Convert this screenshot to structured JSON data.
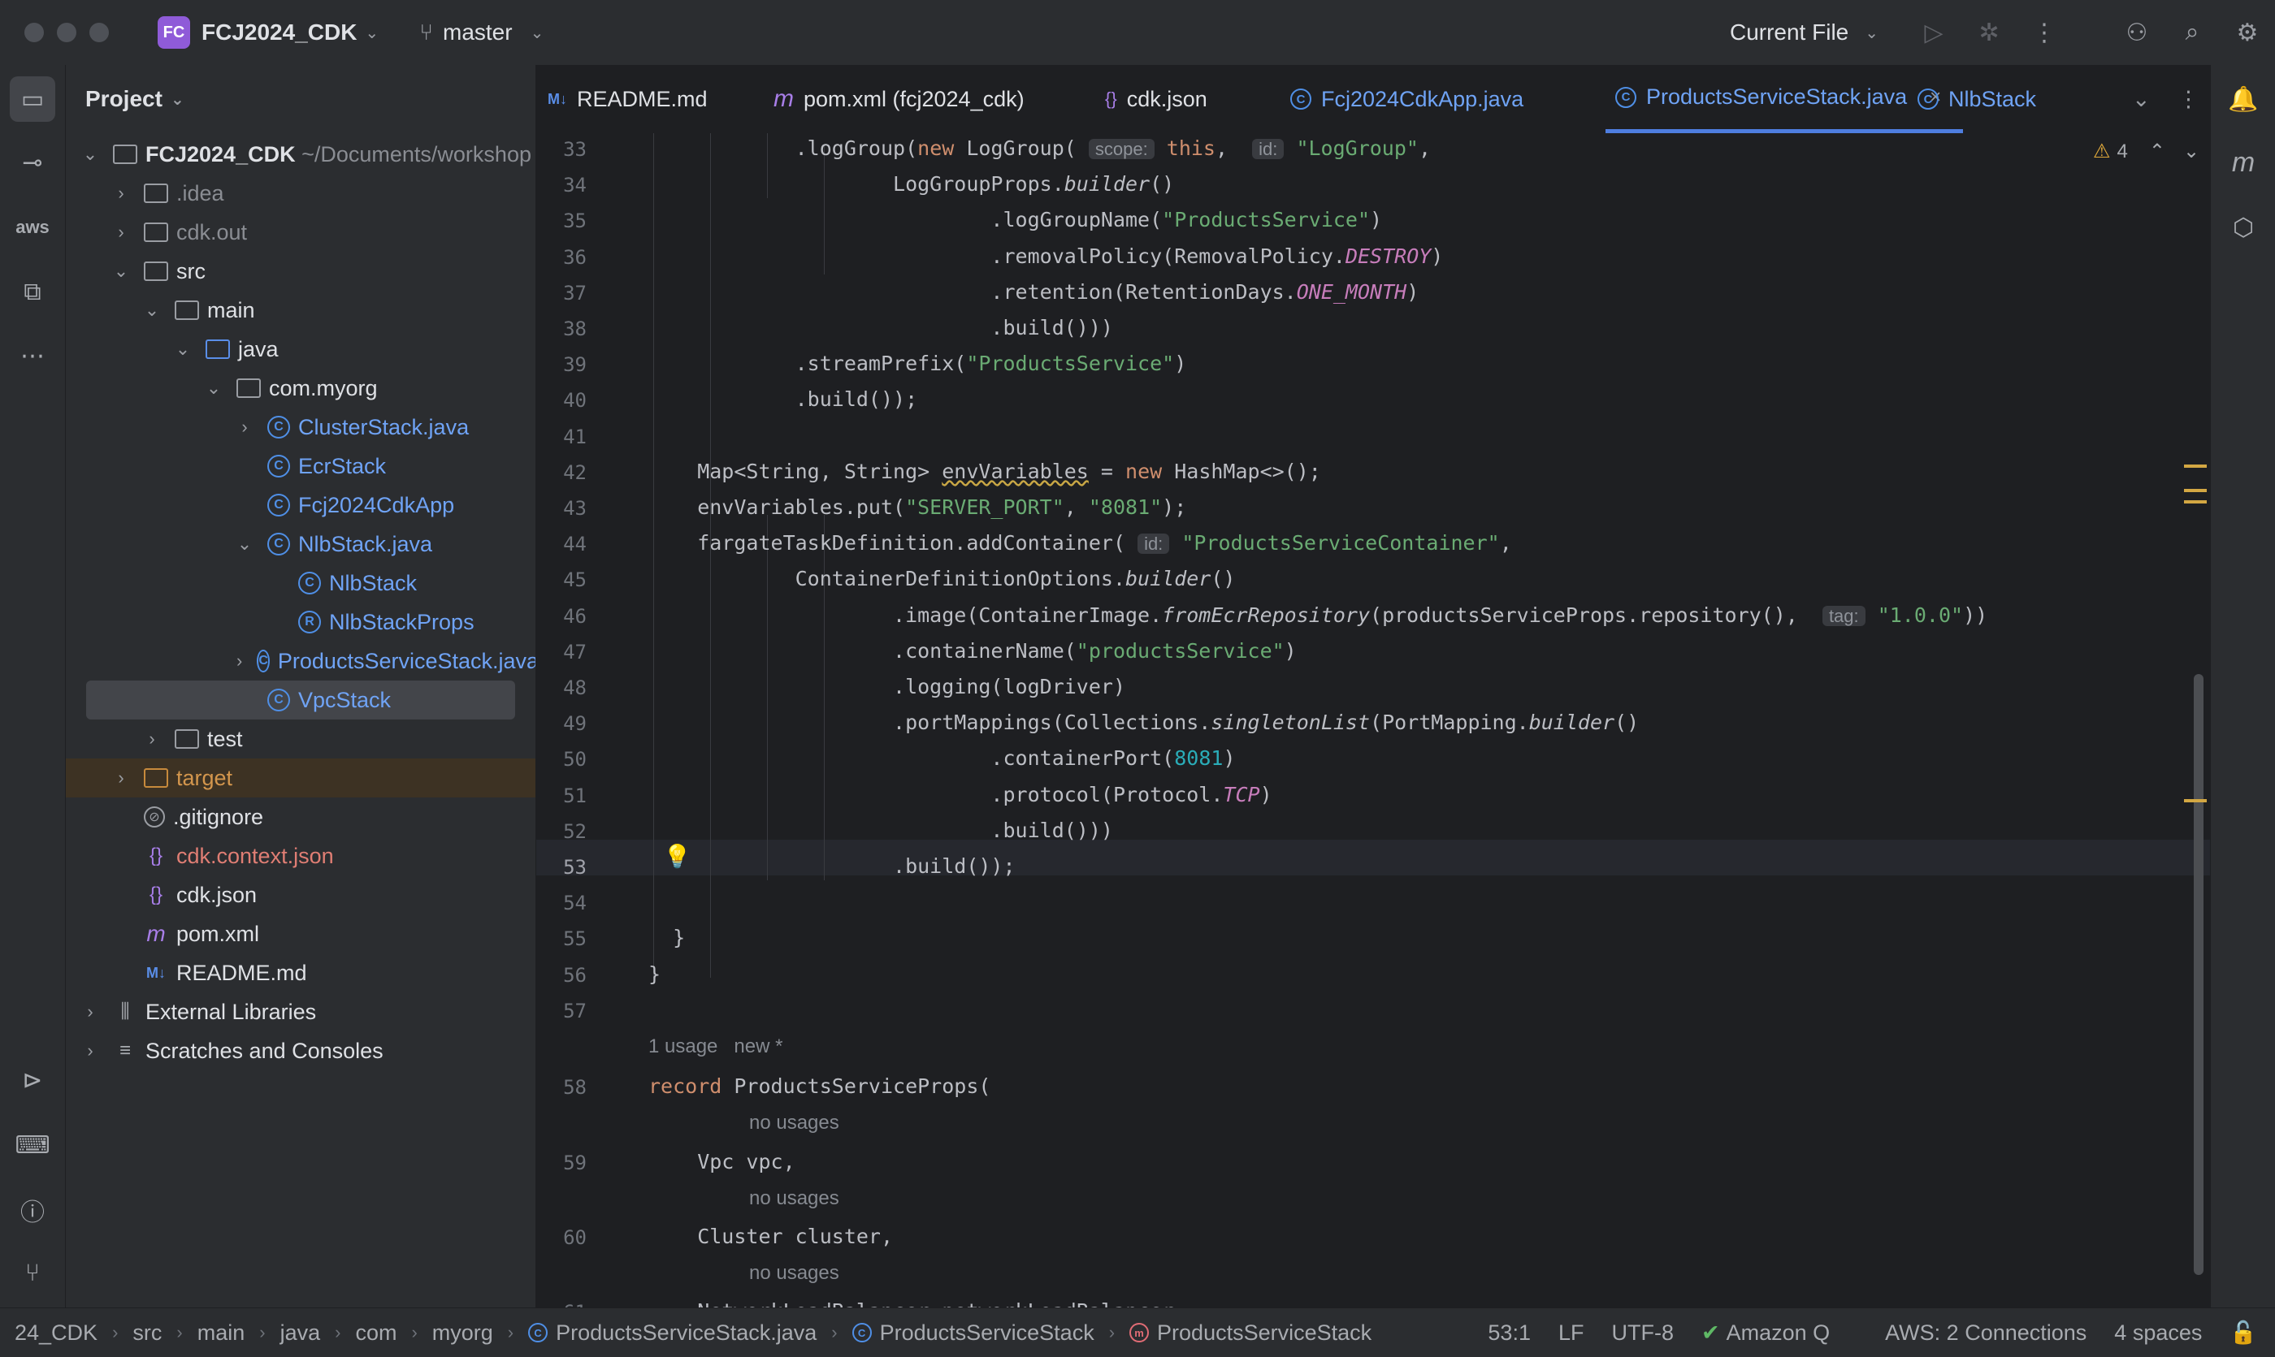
{
  "titlebar": {
    "project_badge": "FC",
    "project_name": "FCJ2024_CDK",
    "branch": "master",
    "run_config": "Current File"
  },
  "project_panel": {
    "title": "Project",
    "tree": [
      {
        "label": "FCJ2024_CDK",
        "suffix": " ~/Documents/workshop",
        "icon": "module-folder-icon",
        "arrow": "down",
        "indent": 0,
        "style": "root"
      },
      {
        "label": ".idea",
        "icon": "folder-icon",
        "arrow": "right",
        "indent": 1,
        "style": "dim"
      },
      {
        "label": "cdk.out",
        "icon": "folder-icon",
        "arrow": "right",
        "indent": 1,
        "style": "dim"
      },
      {
        "label": "src",
        "icon": "folder-icon",
        "arrow": "down",
        "indent": 1,
        "style": "norm"
      },
      {
        "label": "main",
        "icon": "folder-icon",
        "arrow": "down",
        "indent": 2,
        "style": "norm"
      },
      {
        "label": "java",
        "icon": "source-folder-icon",
        "arrow": "down",
        "indent": 3,
        "style": "norm"
      },
      {
        "label": "com.myorg",
        "icon": "package-icon",
        "arrow": "down",
        "indent": 4,
        "style": "norm"
      },
      {
        "label": "ClusterStack.java",
        "icon": "class-icon",
        "arrow": "right",
        "indent": 5,
        "style": "blue"
      },
      {
        "label": "EcrStack",
        "icon": "class-icon",
        "arrow": "none",
        "indent": 5,
        "style": "blue"
      },
      {
        "label": "Fcj2024CdkApp",
        "icon": "class-icon",
        "arrow": "none",
        "indent": 5,
        "style": "blue"
      },
      {
        "label": "NlbStack.java",
        "icon": "class-icon",
        "arrow": "down",
        "indent": 5,
        "style": "blue"
      },
      {
        "label": "NlbStack",
        "icon": "class-icon",
        "arrow": "none",
        "indent": 6,
        "style": "blue"
      },
      {
        "label": "NlbStackProps",
        "icon": "record-icon",
        "arrow": "none",
        "indent": 6,
        "style": "blue"
      },
      {
        "label": "ProductsServiceStack.java",
        "icon": "class-icon",
        "arrow": "right",
        "indent": 5,
        "style": "blue"
      },
      {
        "label": "VpcStack",
        "icon": "class-icon",
        "arrow": "none",
        "indent": 5,
        "style": "blue",
        "selected": true
      },
      {
        "label": "test",
        "icon": "folder-icon",
        "arrow": "right",
        "indent": 2,
        "style": "norm"
      },
      {
        "label": "target",
        "icon": "excluded-folder-icon",
        "arrow": "right",
        "indent": 1,
        "style": "orange",
        "excluded": true
      },
      {
        "label": ".gitignore",
        "icon": "gitignore-icon",
        "arrow": "none",
        "indent": 1,
        "style": "norm"
      },
      {
        "label": "cdk.context.json",
        "icon": "json-icon",
        "arrow": "none",
        "indent": 1,
        "style": "red"
      },
      {
        "label": "cdk.json",
        "icon": "json-icon",
        "arrow": "none",
        "indent": 1,
        "style": "norm"
      },
      {
        "label": "pom.xml",
        "icon": "maven-icon",
        "arrow": "none",
        "indent": 1,
        "style": "norm"
      },
      {
        "label": "README.md",
        "icon": "markdown-icon",
        "arrow": "none",
        "indent": 1,
        "style": "norm"
      },
      {
        "label": "External Libraries",
        "icon": "library-icon",
        "arrow": "right",
        "indent": 0,
        "style": "norm"
      },
      {
        "label": "Scratches and Consoles",
        "icon": "scratches-icon",
        "arrow": "right",
        "indent": 0,
        "style": "norm"
      }
    ]
  },
  "tabs": [
    {
      "label": "README.md",
      "icon": "markdown-icon",
      "glyph": "M↓",
      "color": "#5a8ee8"
    },
    {
      "label": "pom.xml (fcj2024_cdk)",
      "icon": "maven-icon",
      "glyph": "m",
      "color": "#a87ee8"
    },
    {
      "label": "cdk.json",
      "icon": "json-icon",
      "glyph": "{}",
      "color": "#a87ee8"
    },
    {
      "label": "Fcj2024CdkApp.java",
      "icon": "class-icon",
      "glyph": "C",
      "color": "#4f8fe6"
    },
    {
      "label": "ProductsServiceStack.java",
      "icon": "class-icon",
      "glyph": "C",
      "color": "#4f8fe6",
      "active": true
    },
    {
      "label": "NlbStack",
      "icon": "class-icon",
      "glyph": "C",
      "color": "#4f8fe6"
    }
  ],
  "editor": {
    "warning_count": "4",
    "current_line": "53",
    "lines": [
      {
        "n": "33",
        "html": "            .logGroup(<span class=\"kw\">new</span> LogGroup( <span class=\"inlay\">scope:</span> <span class=\"kw\">this</span>,  <span class=\"inlay\">id:</span> <span class=\"str\">\"LogGroup\"</span>,"
      },
      {
        "n": "34",
        "html": "                    LogGroupProps.<span class=\"it\">builder</span>()"
      },
      {
        "n": "35",
        "html": "                            .logGroupName(<span class=\"str\">\"ProductsService\"</span>)"
      },
      {
        "n": "36",
        "html": "                            .removalPolicy(RemovalPolicy.<span class=\"const\">DESTROY</span>)"
      },
      {
        "n": "37",
        "html": "                            .retention(RetentionDays.<span class=\"const\">ONE_MONTH</span>)"
      },
      {
        "n": "38",
        "html": "                            .build()))"
      },
      {
        "n": "39",
        "html": "            .streamPrefix(<span class=\"str\">\"ProductsService\"</span>)"
      },
      {
        "n": "40",
        "html": "            .build());"
      },
      {
        "n": "41",
        "html": ""
      },
      {
        "n": "42",
        "html": "    Map&lt;String, String&gt; <span class=\"warn-ul\">envVariables</span> = <span class=\"kw\">new</span> HashMap&lt;&gt;();"
      },
      {
        "n": "43",
        "html": "    envVariables.put(<span class=\"str\">\"SERVER_PORT\"</span>, <span class=\"str\">\"8081\"</span>);"
      },
      {
        "n": "44",
        "html": "    fargateTaskDefinition.addContainer( <span class=\"inlay\">id:</span> <span class=\"str\">\"ProductsServiceContainer\"</span>,"
      },
      {
        "n": "45",
        "html": "            ContainerDefinitionOptions.<span class=\"it\">builder</span>()"
      },
      {
        "n": "46",
        "html": "                    .image(ContainerImage.<span class=\"it\">fromEcrRepository</span>(productsServiceProps.repository(),  <span class=\"inlay\">tag:</span> <span class=\"str\">\"1.0.0\"</span>))"
      },
      {
        "n": "47",
        "html": "                    .containerName(<span class=\"str\">\"productsService\"</span>)"
      },
      {
        "n": "48",
        "html": "                    .logging(logDriver)"
      },
      {
        "n": "49",
        "html": "                    .portMappings(Collections.<span class=\"it\">singletonList</span>(PortMapping.<span class=\"it\">builder</span>()"
      },
      {
        "n": "50",
        "html": "                            .containerPort(<span class=\"num\">8081</span>)"
      },
      {
        "n": "51",
        "html": "                            .protocol(Protocol.<span class=\"const\">TCP</span>)"
      },
      {
        "n": "52",
        "html": "                            .build()))"
      },
      {
        "n": "53",
        "html": "                    .build());"
      },
      {
        "n": "54",
        "html": ""
      },
      {
        "n": "55",
        "html": "  }"
      },
      {
        "n": "56",
        "html": "}"
      },
      {
        "n": "57",
        "html": ""
      }
    ],
    "usage_hint": "1 usage   new *",
    "record_lines": [
      {
        "n": "58",
        "html": "<span class=\"kw\">record</span> ProductsServiceProps("
      },
      {
        "hint": "no usages"
      },
      {
        "n": "59",
        "html": "    Vpc vpc,"
      },
      {
        "hint": "no usages"
      },
      {
        "n": "60",
        "html": "    Cluster cluster,"
      },
      {
        "hint": "no usages"
      },
      {
        "n": "61",
        "html": "    NetworkLoadBalancer networkLoadBalancer,"
      }
    ]
  },
  "statusbar": {
    "breadcrumbs": [
      {
        "label": "24_CDK",
        "icon": ""
      },
      {
        "label": "src",
        "icon": ""
      },
      {
        "label": "main",
        "icon": ""
      },
      {
        "label": "java",
        "icon": ""
      },
      {
        "label": "com",
        "icon": ""
      },
      {
        "label": "myorg",
        "icon": ""
      },
      {
        "label": "ProductsServiceStack.java",
        "icon": "class-icon"
      },
      {
        "label": "ProductsServiceStack",
        "icon": "class-icon"
      },
      {
        "label": "ProductsServiceStack",
        "icon": "method-icon"
      }
    ],
    "position": "53:1",
    "line_sep": "LF",
    "encoding": "UTF-8",
    "amazon_q": "Amazon Q",
    "aws": "AWS: 2 Connections",
    "indent": "4 spaces"
  }
}
